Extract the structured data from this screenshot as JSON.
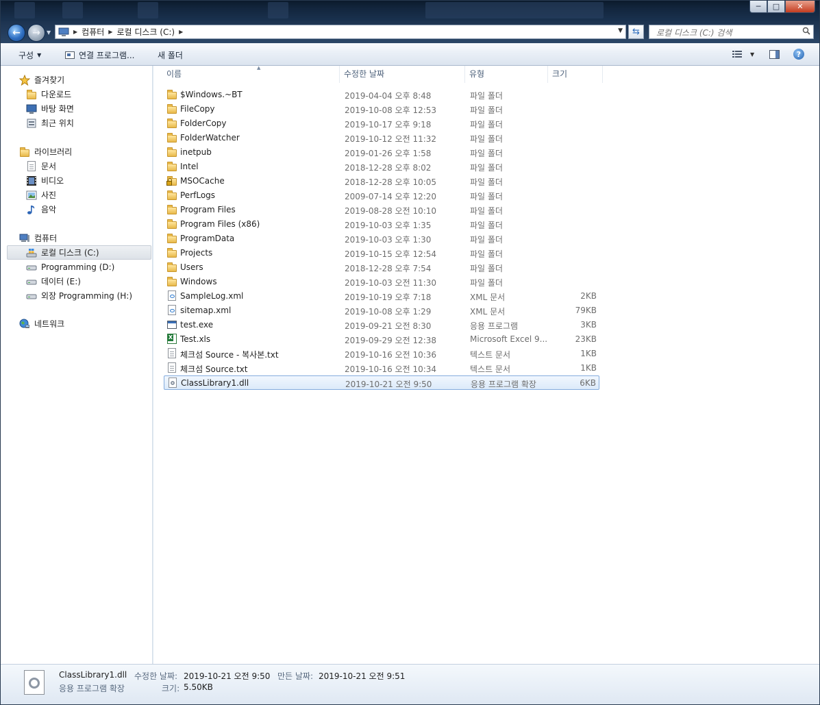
{
  "window": {
    "caption": {
      "minimize": "─",
      "maximize": "□",
      "close": "✕"
    }
  },
  "address": {
    "crumbs": [
      "컴퓨터",
      "로컬 디스크 (C:)"
    ],
    "search_placeholder": "로컬 디스크 (C:) 검색"
  },
  "toolbar": {
    "organize": "구성",
    "open_with": "연결 프로그램...",
    "new_folder": "새 폴더"
  },
  "nav": {
    "favorites": {
      "label": "즐겨찾기",
      "items": [
        "다운로드",
        "바탕 화면",
        "최근 위치"
      ]
    },
    "libraries": {
      "label": "라이브러리",
      "items": [
        "문서",
        "비디오",
        "사진",
        "음악"
      ]
    },
    "computer": {
      "label": "컴퓨터",
      "items": [
        "로컬 디스크 (C:)",
        "Programming (D:)",
        "데이터 (E:)",
        "외장 Programming (H:)"
      ]
    },
    "network": {
      "label": "네트워크"
    }
  },
  "columns": {
    "name": "이름",
    "date": "수정한 날짜",
    "type": "유형",
    "size": "크기"
  },
  "files": [
    {
      "name": "$Windows.~BT",
      "date": "2019-04-04 오후 8:48",
      "type": "파일 폴더",
      "size": "",
      "icon": "folder-icon"
    },
    {
      "name": "FileCopy",
      "date": "2019-10-08 오후 12:53",
      "type": "파일 폴더",
      "size": "",
      "icon": "folder-icon"
    },
    {
      "name": "FolderCopy",
      "date": "2019-10-17 오후 9:18",
      "type": "파일 폴더",
      "size": "",
      "icon": "folder-icon"
    },
    {
      "name": "FolderWatcher",
      "date": "2019-10-12 오전 11:32",
      "type": "파일 폴더",
      "size": "",
      "icon": "folder-icon"
    },
    {
      "name": "inetpub",
      "date": "2019-01-26 오후 1:58",
      "type": "파일 폴더",
      "size": "",
      "icon": "folder-icon"
    },
    {
      "name": "Intel",
      "date": "2018-12-28 오후 8:02",
      "type": "파일 폴더",
      "size": "",
      "icon": "folder-icon"
    },
    {
      "name": "MSOCache",
      "date": "2018-12-28 오후 10:05",
      "type": "파일 폴더",
      "size": "",
      "icon": "locked-folder-icon"
    },
    {
      "name": "PerfLogs",
      "date": "2009-07-14 오후 12:20",
      "type": "파일 폴더",
      "size": "",
      "icon": "folder-icon"
    },
    {
      "name": "Program Files",
      "date": "2019-08-28 오전 10:10",
      "type": "파일 폴더",
      "size": "",
      "icon": "folder-icon"
    },
    {
      "name": "Program Files (x86)",
      "date": "2019-10-03 오후 1:35",
      "type": "파일 폴더",
      "size": "",
      "icon": "folder-icon"
    },
    {
      "name": "ProgramData",
      "date": "2019-10-03 오후 1:30",
      "type": "파일 폴더",
      "size": "",
      "icon": "folder-icon"
    },
    {
      "name": "Projects",
      "date": "2019-10-15 오후 12:54",
      "type": "파일 폴더",
      "size": "",
      "icon": "folder-icon"
    },
    {
      "name": "Users",
      "date": "2018-12-28 오후 7:54",
      "type": "파일 폴더",
      "size": "",
      "icon": "folder-icon"
    },
    {
      "name": "Windows",
      "date": "2019-10-03 오전 11:30",
      "type": "파일 폴더",
      "size": "",
      "icon": "folder-icon"
    },
    {
      "name": "SampleLog.xml",
      "date": "2019-10-19 오후 7:18",
      "type": "XML 문서",
      "size": "2KB",
      "icon": "xml-file-icon"
    },
    {
      "name": "sitemap.xml",
      "date": "2019-10-08 오후 1:29",
      "type": "XML 문서",
      "size": "79KB",
      "icon": "xml-file-icon"
    },
    {
      "name": "test.exe",
      "date": "2019-09-21 오전 8:30",
      "type": "응용 프로그램",
      "size": "3KB",
      "icon": "exe-file-icon"
    },
    {
      "name": "Test.xls",
      "date": "2019-09-29 오전 12:38",
      "type": "Microsoft Excel 9...",
      "size": "23KB",
      "icon": "excel-file-icon"
    },
    {
      "name": "체크섬 Source - 복사본.txt",
      "date": "2019-10-16 오전 10:36",
      "type": "텍스트 문서",
      "size": "1KB",
      "icon": "text-file-icon"
    },
    {
      "name": "체크섬 Source.txt",
      "date": "2019-10-16 오전 10:34",
      "type": "텍스트 문서",
      "size": "1KB",
      "icon": "text-file-icon"
    },
    {
      "name": "ClassLibrary1.dll",
      "date": "2019-10-21 오전 9:50",
      "type": "응용 프로그램 확장",
      "size": "6KB",
      "icon": "dll-file-icon",
      "selected": true
    }
  ],
  "details": {
    "name": "ClassLibrary1.dll",
    "type": "응용 프로그램 확장",
    "modified_label": "수정한 날짜:",
    "modified_value": "2019-10-21 오전 9:50",
    "created_label": "만든 날짜:",
    "created_value": "2019-10-21 오전 9:51",
    "size_label": "크기:",
    "size_value": "5.50KB"
  }
}
